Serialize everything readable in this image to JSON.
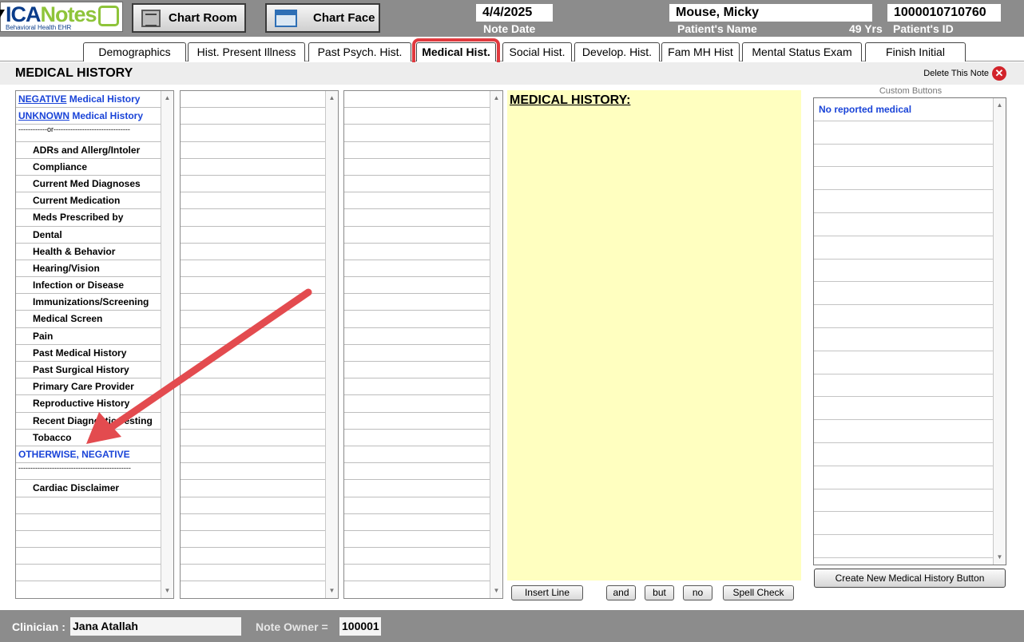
{
  "header": {
    "logo_part1": "ICA",
    "logo_part2": "Notes",
    "logo_subtitle": "Behavioral Health EHR",
    "chart_room_label": "Chart Room",
    "chart_face_label": "Chart Face",
    "note_date": "4/4/2025",
    "note_date_caption": "Note Date",
    "patient_name": "Mouse, Micky",
    "patient_name_caption": "Patient's Name",
    "patient_age": "49 Yrs",
    "patient_id": "1000010710760",
    "patient_id_caption": "Patient's ID"
  },
  "tabs": [
    {
      "label": "Demographics"
    },
    {
      "label": "Hist. Present Illness"
    },
    {
      "label": "Past Psych. Hist."
    },
    {
      "label": "Medical Hist.",
      "active": true
    },
    {
      "label": "Social Hist."
    },
    {
      "label": "Develop. Hist."
    },
    {
      "label": "Fam MH Hist"
    },
    {
      "label": "Mental Status Exam"
    },
    {
      "label": "Finish Initial"
    }
  ],
  "page": {
    "title": "MEDICAL HISTORY",
    "delete_label": "Delete This Note",
    "delete_icon": "close-circle-icon"
  },
  "topic_list": {
    "negative_word": "NEGATIVE",
    "negative_rest": " Medical History",
    "unknown_word": "UNKNOWN",
    "unknown_rest": " Medical History",
    "separator_or": "------------or--------------------------------",
    "items": [
      "ADRs and Allerg/Intoler",
      "Compliance",
      "Current Med Diagnoses",
      "Current Medication",
      "Meds Prescribed by",
      "Dental",
      "Health & Behavior",
      "Hearing/Vision",
      "Infection or Disease",
      "Immunizations/Screening",
      "Medical Screen",
      "Pain",
      "Past Medical History",
      "Past Surgical History",
      "Primary Care Provider",
      "Reproductive History",
      "Recent Diagnostic Testing",
      "Tobacco"
    ],
    "otherwise_label": "OTHERWISE, NEGATIVE",
    "separator_line": "-----------------------------------------------",
    "cardiac_label": "Cardiac Disclaimer"
  },
  "note": {
    "heading": "MEDICAL HISTORY:"
  },
  "note_buttons": {
    "insert_line": "Insert Line",
    "and": "and",
    "but": "but",
    "no": "no",
    "spell_check": "Spell Check"
  },
  "custom_buttons": {
    "caption": "Custom Buttons",
    "items": [
      "No reported medical"
    ],
    "create_label": "Create New Medical History Button"
  },
  "footer": {
    "clinician_label": "Clinician :",
    "clinician_value": "Jana Atallah",
    "owner_label": "Note Owner =",
    "owner_value": "100001"
  },
  "colors": {
    "header_bg": "#8c8c8c",
    "link_blue": "#1a44d8",
    "note_bg": "#ffffc0",
    "highlight_red": "#e0393e",
    "delete_red": "#d2232a"
  }
}
